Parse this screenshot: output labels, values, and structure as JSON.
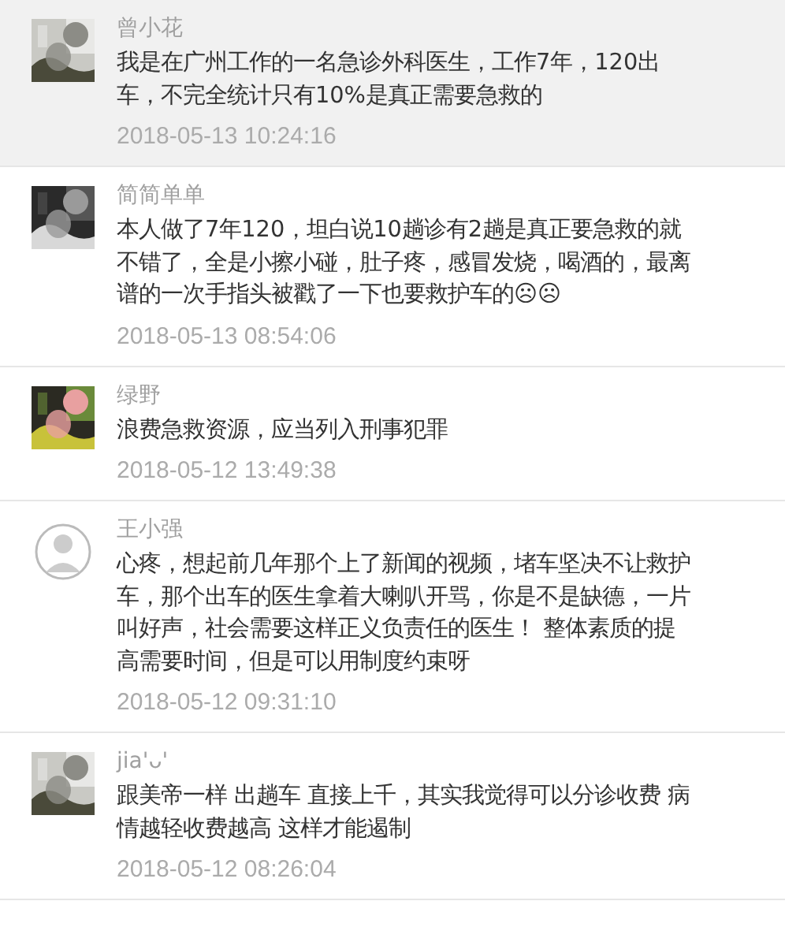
{
  "comments": [
    {
      "name": "曾小花",
      "highlighted": true,
      "text": "我是在广州工作的一名急诊外科医生，工作7年，120出车，不完全统计只有10%是真正需要急救的",
      "time": "2018-05-13 10:24:16"
    },
    {
      "name": "简简单单",
      "highlighted": false,
      "text": "本人做了7年120，坦白说10趟诊有2趟是真正要急救的就不错了，全是小擦小碰，肚子疼，感冒发烧，喝酒的，最离谱的一次手指头被戳了一下也要救护车的☹☹",
      "time": "2018-05-13 08:54:06"
    },
    {
      "name": "绿野",
      "highlighted": false,
      "text": "浪费急救资源，应当列入刑事犯罪",
      "time": "2018-05-12 13:49:38"
    },
    {
      "name": "王小强",
      "highlighted": false,
      "avatar": {
        "kind": "drawing"
      },
      "text": "心疼，想起前几年那个上了新闻的视频，堵车坚决不让救护车，那个出车的医生拿着大喇叭开骂，你是不是缺德，一片叫好声，社会需要这样正义负责任的医生！ 整体素质的提高需要时间，但是可以用制度约束呀",
      "time": "2018-05-12 09:31:10"
    },
    {
      "name": "jia'ᴗ'",
      "highlighted": false,
      "text": "跟美帝一样 出趟车 直接上千，其实我觉得可以分诊收费 病情越轻收费越高 这样才能遏制",
      "time": "2018-05-12 08:26:04"
    }
  ]
}
